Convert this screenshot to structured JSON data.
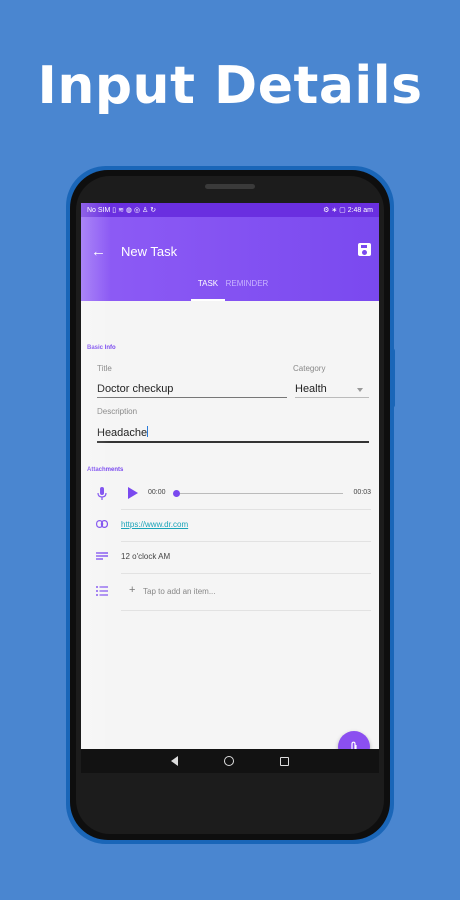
{
  "headline": "Input Details",
  "status_bar": {
    "left": "No SIM ▯ ≋ ◍ ◎ ♙ ↻",
    "right": "⚙ ∗ ▢ 2:48 am"
  },
  "app_bar": {
    "title": "New Task",
    "back_icon": "arrow-back-icon",
    "save_icon": "save-icon"
  },
  "tabs": [
    {
      "label": "TASK",
      "active": true
    },
    {
      "label": "REMINDER",
      "active": false
    }
  ],
  "basic_info": {
    "section_label": "Basic Info",
    "title_label": "Title",
    "title_value": "Doctor checkup",
    "category_label": "Category",
    "category_value": "Health",
    "description_label": "Description",
    "description_value": "Headache"
  },
  "attachments": {
    "section_label": "Attachments",
    "audio": {
      "current_time": "00:00",
      "duration": "00:03",
      "icon": "microphone-icon",
      "progress": 0
    },
    "link": {
      "url": "https://www.dr.com",
      "icon": "link-icon"
    },
    "note": {
      "text": "12 o'clock AM",
      "icon": "notes-icon"
    },
    "checklist": {
      "placeholder": "Tap to add an item...",
      "icon": "list-icon"
    }
  },
  "fab": {
    "icon": "paperclip-icon"
  },
  "colors": {
    "accent": "#7a49ef",
    "background": "#4a86d0",
    "link": "#1aa3b8"
  }
}
